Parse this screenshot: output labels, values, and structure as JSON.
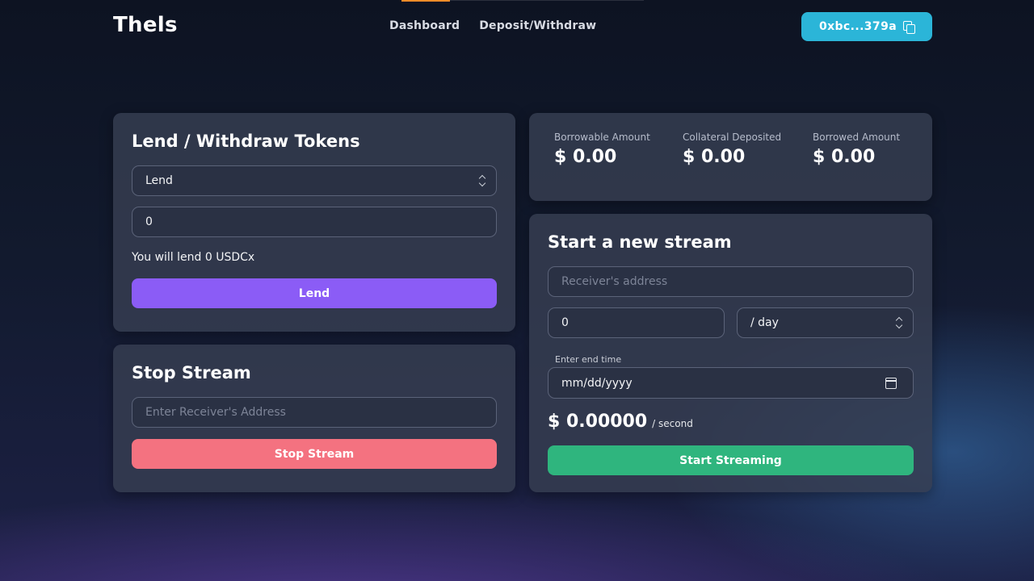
{
  "header": {
    "logo": "Thels",
    "nav": [
      {
        "label": "Dashboard"
      },
      {
        "label": "Deposit/Withdraw"
      }
    ],
    "wallet_label": "0xbc...379a"
  },
  "lend_card": {
    "title": "Lend / Withdraw Tokens",
    "mode_selected": "Lend",
    "amount_value": "0",
    "summary": "You will lend 0 USDCx",
    "button_label": "Lend",
    "button_color": "#8b5cf6"
  },
  "stop_card": {
    "title": "Stop Stream",
    "address_placeholder": "Enter Receiver's Address",
    "button_label": "Stop Stream",
    "button_color": "#f47280"
  },
  "stats": [
    {
      "label": "Borrowable Amount",
      "value": "$ 0.00"
    },
    {
      "label": "Collateral Deposited",
      "value": "$ 0.00"
    },
    {
      "label": "Borrowed Amount",
      "value": "$ 0.00"
    }
  ],
  "stream_card": {
    "title": "Start a new stream",
    "receiver_placeholder": "Receiver's address",
    "rate_value": "0",
    "period_selected": "/ day",
    "end_time_label": "Enter end time",
    "end_time_placeholder": "mm/dd/yyyy",
    "flow_amount": "$ 0.00000",
    "flow_unit": "/ second",
    "button_label": "Start Streaming",
    "button_color": "#2fb57e"
  },
  "icons": {
    "copy": "copy-icon",
    "select": "chevron-updown-icon",
    "calendar": "calendar-icon"
  }
}
